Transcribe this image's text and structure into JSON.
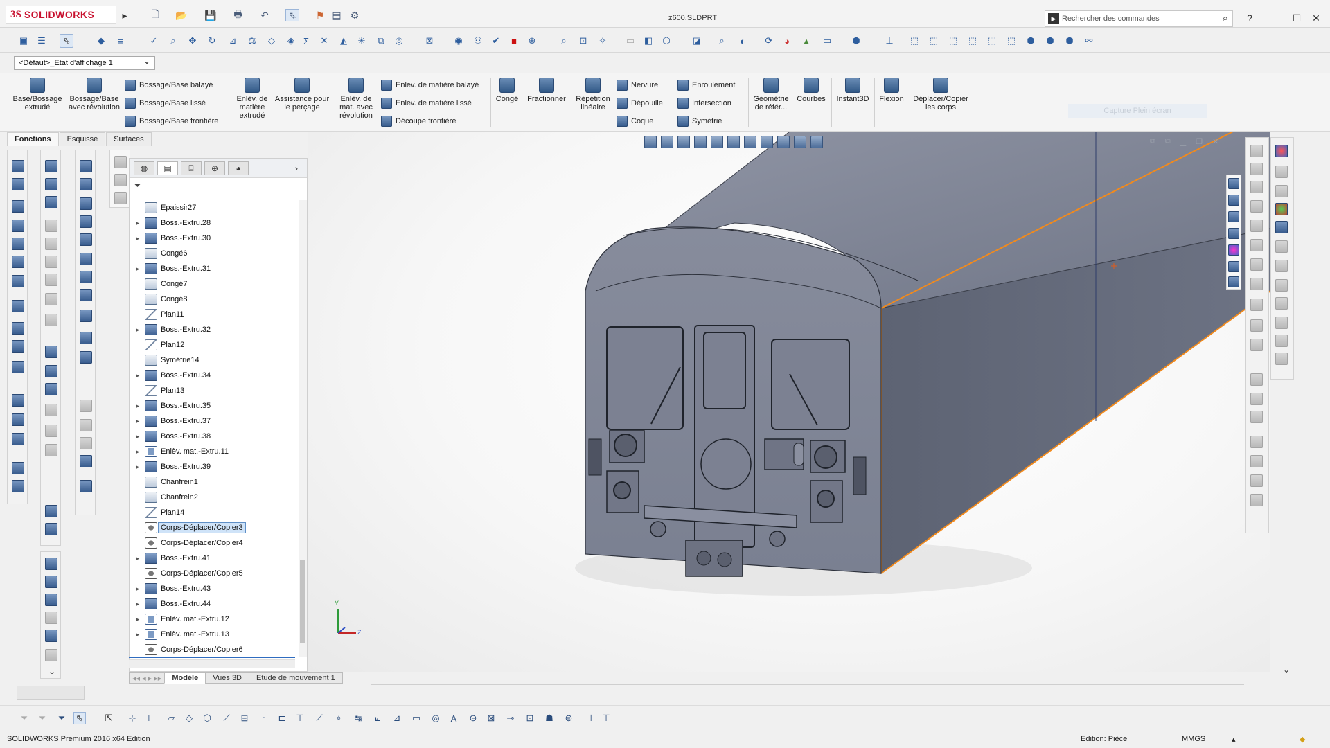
{
  "app": {
    "brand_prefix": "3S",
    "brand_name": "SOLIDWORKS",
    "document_title": "z600.SLDPRT",
    "search_placeholder": "Rechercher des commandes",
    "help_label": "?",
    "min_label": "—",
    "max_label": "☐",
    "close_label": "✕"
  },
  "config": {
    "selected": "<Défaut>_Etat d'affichage 1"
  },
  "command_manager": {
    "buttons": [
      {
        "label": "Base/Bossage extrudé"
      },
      {
        "label": "Bossage/Base avec révolution"
      },
      {
        "label": "Bossage/Base balayé"
      },
      {
        "label": "Bossage/Base lissé"
      },
      {
        "label": "Bossage/Base frontière"
      },
      {
        "label": "Enlèv. de matière extrudé"
      },
      {
        "label": "Assistance pour le perçage"
      },
      {
        "label": "Enlèv. de mat. avec révolution"
      },
      {
        "label": "Enlèv. de matière balayé"
      },
      {
        "label": "Enlèv. de matière lissé"
      },
      {
        "label": "Découpe frontière"
      },
      {
        "label": "Congé"
      },
      {
        "label": "Fractionner"
      },
      {
        "label": "Répétition linéaire"
      },
      {
        "label": "Nervure"
      },
      {
        "label": "Dépouille"
      },
      {
        "label": "Coque"
      },
      {
        "label": "Enroulement"
      },
      {
        "label": "Intersection"
      },
      {
        "label": "Symétrie"
      },
      {
        "label": "Géométrie de référ..."
      },
      {
        "label": "Courbes"
      },
      {
        "label": "Instant3D"
      },
      {
        "label": "Flexion"
      },
      {
        "label": "Déplacer/Copier les corps"
      }
    ],
    "capture_label": "Capture Plein écran",
    "tabs": [
      {
        "label": "Fonctions",
        "active": true
      },
      {
        "label": "Esquisse",
        "active": false
      },
      {
        "label": "Surfaces",
        "active": false
      }
    ]
  },
  "feature_tree": {
    "items": [
      {
        "label": "Epaissir27",
        "expandable": false,
        "icon": "fillet-icon"
      },
      {
        "label": "Boss.-Extru.28",
        "expandable": true,
        "icon": "boss-extrude-icon"
      },
      {
        "label": "Boss.-Extru.30",
        "expandable": true,
        "icon": "boss-extrude-icon"
      },
      {
        "label": "Congé6",
        "expandable": false,
        "icon": "fillet-icon"
      },
      {
        "label": "Boss.-Extru.31",
        "expandable": true,
        "icon": "boss-extrude-icon"
      },
      {
        "label": "Congé7",
        "expandable": false,
        "icon": "fillet-icon"
      },
      {
        "label": "Congé8",
        "expandable": false,
        "icon": "fillet-icon"
      },
      {
        "label": "Plan11",
        "expandable": false,
        "icon": "plane-icon"
      },
      {
        "label": "Boss.-Extru.32",
        "expandable": true,
        "icon": "boss-extrude-icon"
      },
      {
        "label": "Plan12",
        "expandable": false,
        "icon": "plane-icon"
      },
      {
        "label": "Symétrie14",
        "expandable": false,
        "icon": "mirror-icon"
      },
      {
        "label": "Boss.-Extru.34",
        "expandable": true,
        "icon": "boss-extrude-icon"
      },
      {
        "label": "Plan13",
        "expandable": false,
        "icon": "plane-icon"
      },
      {
        "label": "Boss.-Extru.35",
        "expandable": true,
        "icon": "boss-extrude-icon"
      },
      {
        "label": "Boss.-Extru.37",
        "expandable": true,
        "icon": "boss-extrude-icon"
      },
      {
        "label": "Boss.-Extru.38",
        "expandable": true,
        "icon": "boss-extrude-icon"
      },
      {
        "label": "Enlèv. mat.-Extru.11",
        "expandable": true,
        "icon": "cut-extrude-icon"
      },
      {
        "label": "Boss.-Extru.39",
        "expandable": true,
        "icon": "boss-extrude-icon"
      },
      {
        "label": "Chanfrein1",
        "expandable": false,
        "icon": "chamfer-icon"
      },
      {
        "label": "Chanfrein2",
        "expandable": false,
        "icon": "chamfer-icon"
      },
      {
        "label": "Plan14",
        "expandable": false,
        "icon": "plane-icon"
      },
      {
        "label": "Corps-Déplacer/Copier3",
        "expandable": false,
        "icon": "move-copy-icon",
        "selected": true
      },
      {
        "label": "Corps-Déplacer/Copier4",
        "expandable": false,
        "icon": "move-copy-icon"
      },
      {
        "label": "Boss.-Extru.41",
        "expandable": true,
        "icon": "boss-extrude-icon"
      },
      {
        "label": "Corps-Déplacer/Copier5",
        "expandable": false,
        "icon": "move-copy-icon"
      },
      {
        "label": "Boss.-Extru.43",
        "expandable": true,
        "icon": "boss-extrude-icon"
      },
      {
        "label": "Boss.-Extru.44",
        "expandable": true,
        "icon": "boss-extrude-icon"
      },
      {
        "label": "Enlèv. mat.-Extru.12",
        "expandable": true,
        "icon": "cut-extrude-icon"
      },
      {
        "label": "Enlèv. mat.-Extru.13",
        "expandable": true,
        "icon": "cut-extrude-icon"
      },
      {
        "label": "Corps-Déplacer/Copier6",
        "expandable": false,
        "icon": "move-copy-icon"
      }
    ]
  },
  "bottom_tabs": [
    {
      "label": "Modèle",
      "active": true
    },
    {
      "label": "Vues 3D",
      "active": false
    },
    {
      "label": "Etude de mouvement 1",
      "active": false
    }
  ],
  "triad": {
    "y": "Y",
    "z": "Z"
  },
  "status": {
    "edition": "SOLIDWORKS Premium 2016 x64 Edition",
    "mode": "Edition: Pièce",
    "units": "MMGS"
  },
  "colors": {
    "model_body": "#676d7d",
    "model_top": "#7a8091",
    "selected_edge": "#f28a1c",
    "brand_red": "#c8102e"
  }
}
